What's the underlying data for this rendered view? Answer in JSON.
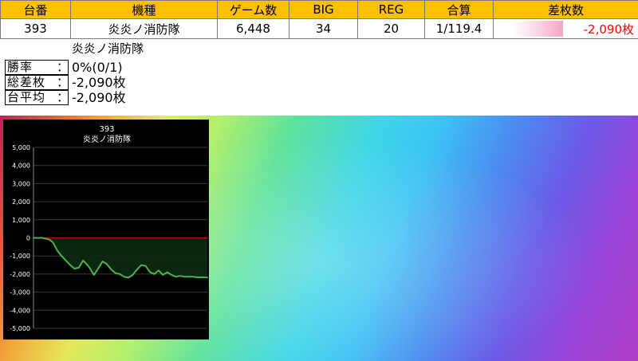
{
  "table": {
    "headers": [
      "台番",
      "機種",
      "ゲーム数",
      "BIG",
      "REG",
      "合算",
      "差枚数"
    ],
    "row": {
      "number": "393",
      "machine": "炎炎ノ消防隊",
      "games": "6,448",
      "big": "34",
      "reg": "20",
      "combined": "1/119.4",
      "diff": "-2,090枚"
    }
  },
  "heading": {
    "machine": "炎炎ノ消防隊"
  },
  "stats": [
    {
      "label": "勝率",
      "value": "0%(0/1)"
    },
    {
      "label": "総差枚",
      "value": "-2,090枚"
    },
    {
      "label": "台平均",
      "value": "-2,090枚"
    }
  ],
  "stat_colon": "：",
  "colors": {
    "header_bg": "#ffc000",
    "diff_text": "#ff0000",
    "chart_bg": "#000000",
    "zero_line": "#cc0000",
    "series_line": "#4ab54a"
  },
  "chart_data": {
    "type": "line",
    "title": "393",
    "subtitle": "炎炎ノ消防隊",
    "xlabel": "",
    "ylabel": "",
    "ylim": [
      -5000,
      5000
    ],
    "y_ticks": [
      "5,000",
      "4,000",
      "3,000",
      "2,000",
      "1,000",
      "0",
      "-1,000",
      "-2,000",
      "-3,000",
      "-4,000",
      "-5,000"
    ],
    "y_tick_values": [
      5000,
      4000,
      3000,
      2000,
      1000,
      0,
      -1000,
      -2000,
      -3000,
      -4000,
      -5000
    ],
    "grid": true,
    "xlim": [
      0,
      6448
    ],
    "series": [
      {
        "x": [
          0,
          160,
          320,
          480,
          600,
          720,
          880,
          1040,
          1200,
          1360,
          1520,
          1680,
          1840,
          2000,
          2080,
          2240,
          2400,
          2560,
          2720,
          2880,
          3040,
          3200,
          3360,
          3520,
          3680,
          3840,
          4000,
          4160,
          4320,
          4480,
          4640,
          4800,
          4960,
          5120,
          5280,
          5440,
          5600,
          5760,
          5920,
          6080,
          6240,
          6448
        ],
        "y": [
          0,
          0,
          0,
          -50,
          -100,
          -250,
          -700,
          -1000,
          -1250,
          -1500,
          -1700,
          -1650,
          -1250,
          -1500,
          -1650,
          -2050,
          -1700,
          -1300,
          -1450,
          -1750,
          -1950,
          -2000,
          -2150,
          -2200,
          -2050,
          -1750,
          -1500,
          -1550,
          -1900,
          -2000,
          -1800,
          -2050,
          -1900,
          -2050,
          -2150,
          -2100,
          -2150,
          -2150,
          -2150,
          -2180,
          -2180,
          -2190
        ]
      }
    ]
  }
}
